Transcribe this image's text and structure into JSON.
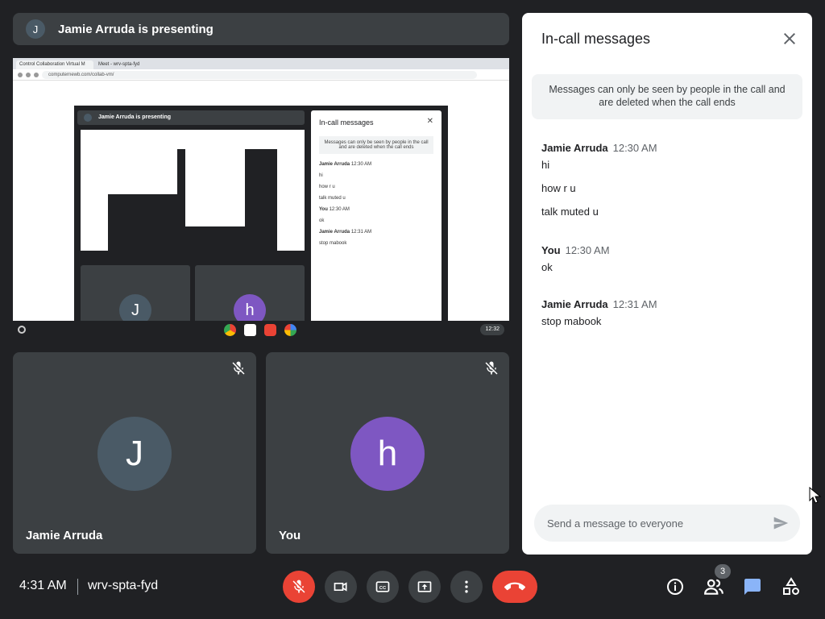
{
  "presenter": {
    "initial": "J",
    "text": "Jamie Arruda is presenting"
  },
  "shared_screen": {
    "tabs": [
      "Control Collaboration Virtual M",
      "Meet - wrv-spta-fyd"
    ],
    "url": "computernewb.com/collab-vm/",
    "nested_presenter_text": "Jamie Arruda is presenting",
    "nested_chat": {
      "title": "In-call messages",
      "notice": "Messages can only be seen by people in the call and are deleted when the call ends",
      "lines": [
        {
          "name": "Jamie Arruda",
          "time": "12:30 AM"
        },
        {
          "text": "hi"
        },
        {
          "text": "how r u"
        },
        {
          "text": "talk muted u"
        },
        {
          "name": "You",
          "time": "12:30 AM"
        },
        {
          "text": "ok"
        },
        {
          "name": "Jamie Arruda",
          "time": "12:31 AM"
        },
        {
          "text": "stop mabook"
        }
      ]
    },
    "nested_tiles": [
      {
        "initial": "J",
        "color": "#4a5a66"
      },
      {
        "initial": "h",
        "color": "#7e57c2"
      }
    ],
    "taskbar_time": "12:32"
  },
  "tiles": [
    {
      "name": "Jamie Arruda",
      "initial": "J",
      "color": "#4a5a66",
      "muted": true
    },
    {
      "name": "You",
      "initial": "h",
      "color": "#7e57c2",
      "muted": true
    }
  ],
  "chat": {
    "title": "In-call messages",
    "notice": "Messages can only be seen by people in the call and are deleted when the call ends",
    "messages": [
      {
        "sender": "Jamie Arruda",
        "time": "12:30 AM",
        "lines": [
          "hi",
          "how r u",
          "talk muted u"
        ]
      },
      {
        "sender": "You",
        "time": "12:30 AM",
        "lines": [
          "ok"
        ]
      },
      {
        "sender": "Jamie Arruda",
        "time": "12:31 AM",
        "lines": [
          "stop mabook"
        ]
      }
    ],
    "input_placeholder": "Send a message to everyone"
  },
  "bottom_bar": {
    "time": "4:31 AM",
    "meeting_code": "wrv-spta-fyd",
    "participant_count": "3",
    "controls": [
      "mic-off",
      "camera",
      "captions",
      "present",
      "more-options",
      "end-call"
    ],
    "right_icons": [
      "info",
      "people",
      "chat",
      "activities"
    ]
  },
  "colors": {
    "end_call": "#ea4335",
    "chat_active": "#8ab4f8",
    "control_bg": "#3c4043"
  }
}
